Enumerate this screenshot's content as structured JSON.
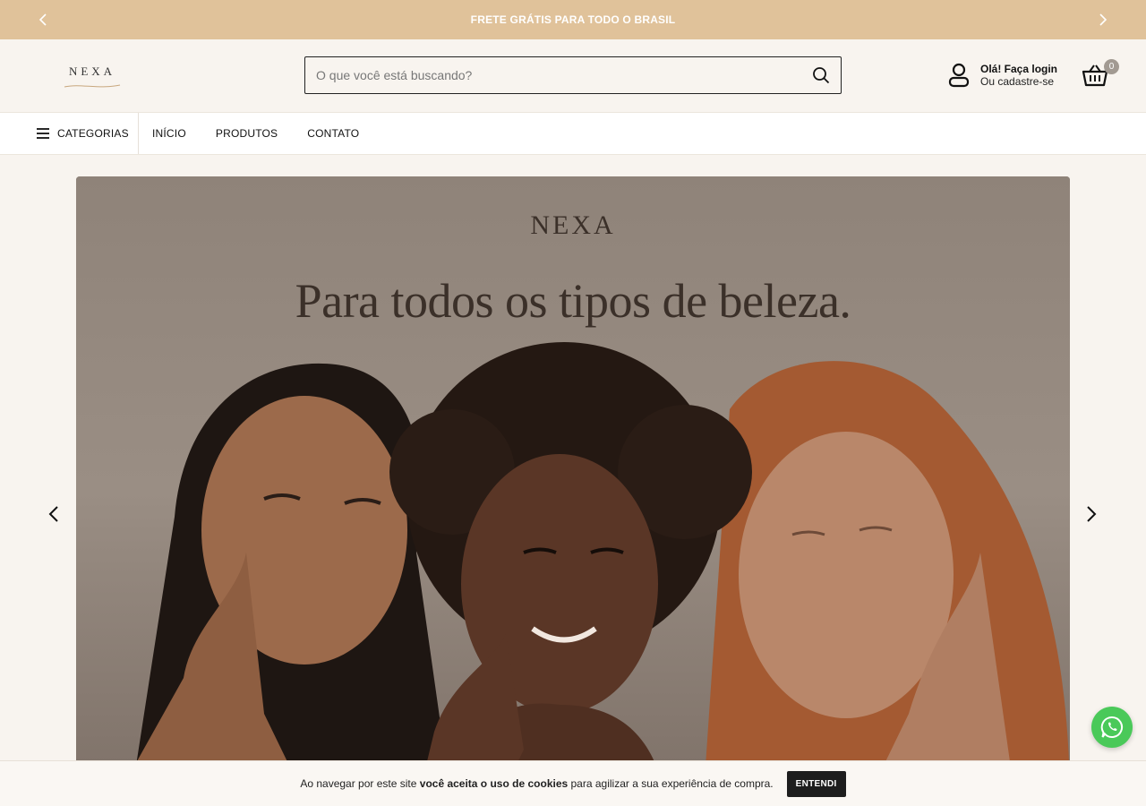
{
  "topbar": {
    "message": "FRETE GRÁTIS PARA TODO O BRASIL",
    "prev_icon": "chevron-left-icon",
    "next_icon": "chevron-right-icon",
    "background": "#e0c29a"
  },
  "header": {
    "logo_text": "NEXA",
    "search": {
      "placeholder": "O que você está buscando?",
      "value": "",
      "icon": "search-icon"
    },
    "account": {
      "greeting": "Olá! Faça login",
      "subtitle": "Ou cadastre-se",
      "icon": "user-icon"
    },
    "cart": {
      "count": "0",
      "icon": "basket-icon"
    }
  },
  "nav": {
    "categories_label": "CATEGORIAS",
    "links": [
      "INÍCIO",
      "PRODUTOS",
      "CONTATO"
    ]
  },
  "hero": {
    "brand": "NEXA",
    "title": "Para todos os tipos de beleza.",
    "prev_icon": "chevron-left-icon",
    "next_icon": "chevron-right-icon"
  },
  "whatsapp": {
    "icon": "whatsapp-icon",
    "color": "#4ac959"
  },
  "cookie": {
    "text_before": "Ao navegar por este site ",
    "text_bold": "você aceita o uso de cookies",
    "text_after": " para agilizar a sua experiência de compra.",
    "button": "ENTENDI"
  },
  "colors": {
    "page_bg": "#f8f4ef",
    "accent": "#e0c29a",
    "dark": "#1d1d1d"
  }
}
